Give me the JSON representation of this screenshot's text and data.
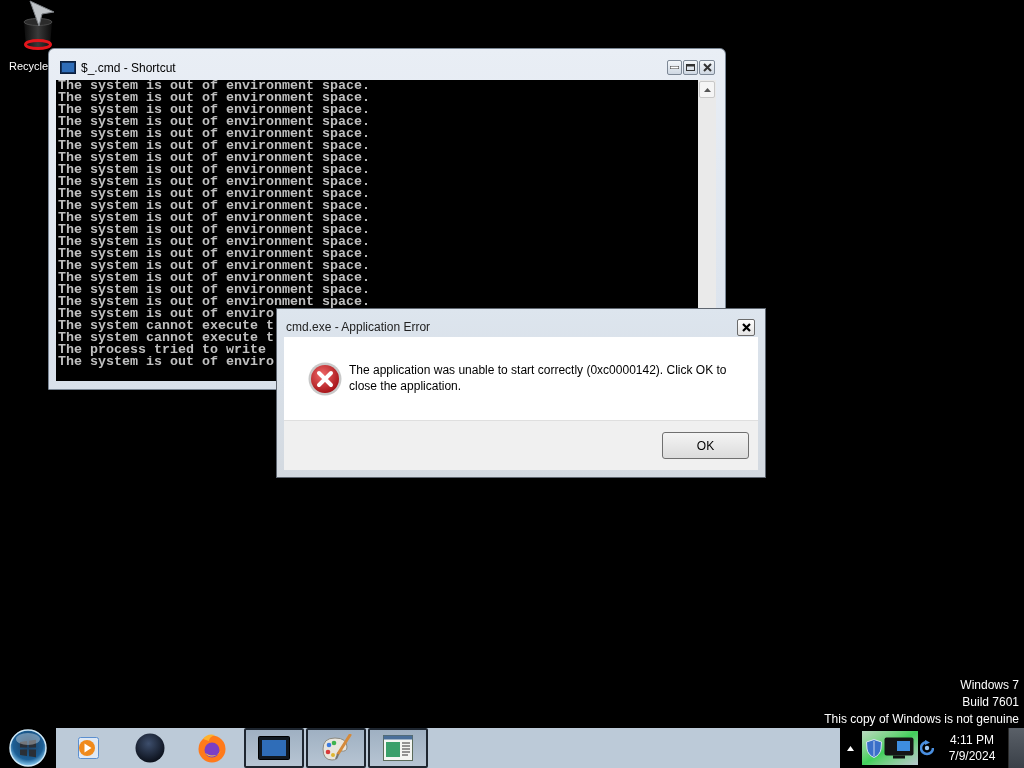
{
  "desktop": {
    "icons": [
      {
        "label": "Recycle"
      }
    ],
    "notice_lines": [
      "Windows 7",
      "Build 7601",
      "This copy of Windows is not genuine"
    ]
  },
  "console_window": {
    "title": "$_.cmd - Shortcut",
    "lines": [
      "The system is out of environment space.",
      "The system is out of environment space.",
      "The system is out of environment space.",
      "The system is out of environment space.",
      "The system is out of environment space.",
      "The system is out of environment space.",
      "The system is out of environment space.",
      "The system is out of environment space.",
      "The system is out of environment space.",
      "The system is out of environment space.",
      "The system is out of environment space.",
      "The system is out of environment space.",
      "The system is out of environment space.",
      "The system is out of environment space.",
      "The system is out of environment space.",
      "The system is out of environment space.",
      "The system is out of environment space.",
      "The system is out of environment space.",
      "The system is out of environment space.",
      "The system is out of enviro",
      "The system cannot execute t",
      "The system cannot execute t",
      "The process tried to write",
      "The system is out of enviro"
    ]
  },
  "error_dialog": {
    "title": "cmd.exe - Application Error",
    "message": "The application was unable to start correctly (0xc0000142). Click OK to close the application.",
    "buttons": [
      "OK"
    ]
  },
  "taskbar": {
    "buttons": [
      {
        "open": false
      },
      {
        "open": false
      },
      {
        "open": false
      },
      {
        "open": true
      },
      {
        "open": true
      },
      {
        "open": true
      }
    ],
    "clock": {
      "time": "4:11 PM",
      "date": "7/9/2024"
    }
  }
}
